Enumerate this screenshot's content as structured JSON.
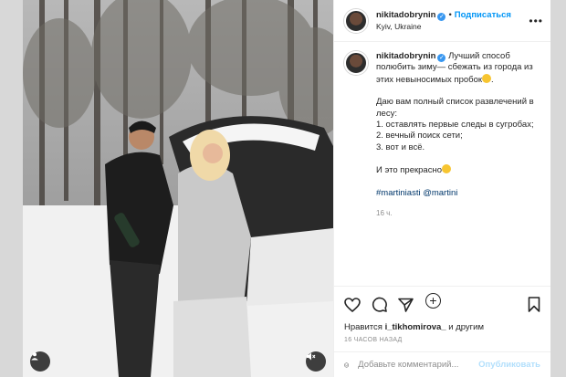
{
  "post": {
    "username": "nikitadobrynin",
    "follow_label": "Подписаться",
    "location": "Kyiv, Ukraine",
    "caption_lines": {
      "p1": "Лучший способ полюбить зиму— сбежать из города из этих невыносимых пробок",
      "p2a": "Даю вам полный список развлечений в лесу:",
      "p2b": "1. оставлять первые следы в сугробах;",
      "p2c": "2. вечный поиск сети;",
      "p2d": "3. вот и всё.",
      "p3": "И это прекрасно",
      "tags": "#martiniasti @martini"
    },
    "caption_time": "16 ч.",
    "likes_prefix": "Нравится",
    "likes_user": "i_tikhomirova_",
    "likes_suffix": "и другим",
    "posted_ago": "16 ЧАСОВ НАЗАД",
    "comment_placeholder": "Добавьте комментарий...",
    "publish_label": "Опубликовать"
  },
  "icons": {
    "heart": "heart-icon",
    "comment": "comment-icon",
    "share": "share-icon",
    "save": "bookmark-icon",
    "more": "more-icon",
    "emoji": "smile-icon",
    "mute": "muted-speaker-icon",
    "tag": "user-tag-icon",
    "plus": "plus-circle-icon"
  },
  "colors": {
    "accent": "#0095f6",
    "text": "#262626",
    "muted": "#8e8e8e",
    "verified": "#3897f0"
  }
}
